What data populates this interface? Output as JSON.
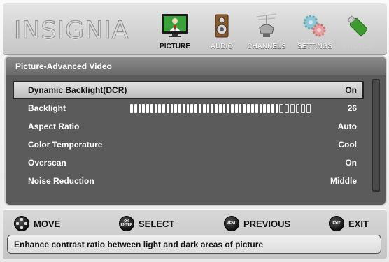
{
  "brand": {
    "logo_text": "INSIGNIA"
  },
  "menu_tabs": [
    {
      "label": "PICTURE",
      "icon": "tv-picture-icon",
      "active": true
    },
    {
      "label": "AUDIO",
      "icon": "speaker-icon",
      "active": false
    },
    {
      "label": "CHANNELS",
      "icon": "antenna-icon",
      "active": false
    },
    {
      "label": "SETTINGS",
      "icon": "gears-icon",
      "active": false
    },
    {
      "label": "PHOTOS",
      "icon": "usb-drive-icon",
      "active": false,
      "disabled": true
    }
  ],
  "panel": {
    "title": "Picture-Advanced Video",
    "settings": [
      {
        "label": "Dynamic Backlight(DCR)",
        "value": "On",
        "selected": true
      },
      {
        "label": "Backlight",
        "value": "26",
        "level_fraction": 0.87
      },
      {
        "label": "Aspect Ratio",
        "value": "Auto"
      },
      {
        "label": "Color Temperature",
        "value": "Cool"
      },
      {
        "label": "Overscan",
        "value": "On"
      },
      {
        "label": "Noise Reduction",
        "value": "Middle"
      }
    ]
  },
  "footer": {
    "hints": [
      {
        "icon": "dpad-icon",
        "label": "MOVE"
      },
      {
        "icon": "ok-enter-button-icon",
        "icon_text": "OK\nENTER",
        "label": "SELECT"
      },
      {
        "icon": "menu-button-icon",
        "icon_text": "MENU",
        "label": "PREVIOUS"
      },
      {
        "icon": "exit-button-icon",
        "icon_text": "EXIT",
        "label": "EXIT"
      }
    ],
    "help_text": "Enhance contrast ratio between light and dark areas of picture"
  },
  "colors": {
    "panel_bg": "#5b5b5b",
    "selected_row": "#d0d0d0",
    "header_bg": "#d3d3d3",
    "active_tab_label": "#111111",
    "inactive_tab_label": "#f2f2f2"
  }
}
